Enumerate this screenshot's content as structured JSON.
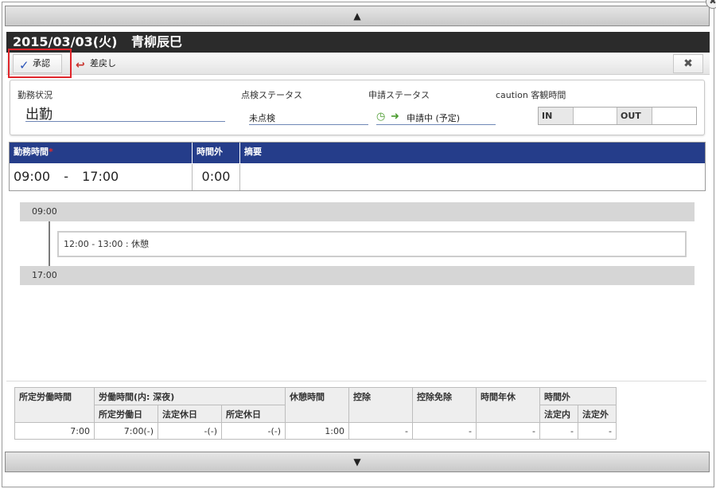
{
  "scroll": {
    "up_arrow": "▲",
    "down_arrow": "▼"
  },
  "close_glyph": "✖",
  "header": {
    "date": "2015/03/03(火)",
    "name": "青柳辰巳"
  },
  "toolbar": {
    "approve_icon": "✓",
    "approve_label": "承認",
    "return_icon": "↩",
    "return_label": "差戻し",
    "close_glyph": "✖"
  },
  "status": {
    "work_label": "勤務状況",
    "work_value": "出勤",
    "check_label": "点検ステータス",
    "check_value": "未点検",
    "apply_label": "申請ステータス",
    "apply_value": "申請中 (予定)",
    "caution_label": "caution 客観時間",
    "in_label": "IN",
    "in_value": "",
    "out_label": "OUT",
    "out_value": ""
  },
  "work_table": {
    "headers": {
      "time": "勤務時間",
      "required_mark": "*",
      "overtime": "時間外",
      "summary": "摘要"
    },
    "row": {
      "start": "09:00",
      "dash": "-",
      "end": "17:00",
      "overtime": "0:00",
      "summary": ""
    }
  },
  "timeline": {
    "start": "09:00",
    "end": "17:00",
    "break_entry": "12:00 - 13:00 : 休憩"
  },
  "summary_table": {
    "headers": {
      "scheduled": "所定労働時間",
      "working": "労働時間(内: 深夜)",
      "working_sub": [
        "所定労働日",
        "法定休日",
        "所定休日"
      ],
      "break": "休憩時間",
      "deduction": "控除",
      "deduction_exempt": "控除免除",
      "hourly_leave": "時間年休",
      "overtime": "時間外",
      "overtime_sub": [
        "法定内",
        "法定外"
      ]
    },
    "values": [
      "7:00",
      "7:00(-)",
      "-(-)",
      "-(-)",
      "1:00",
      "-",
      "-",
      "-",
      "-",
      "-"
    ]
  }
}
